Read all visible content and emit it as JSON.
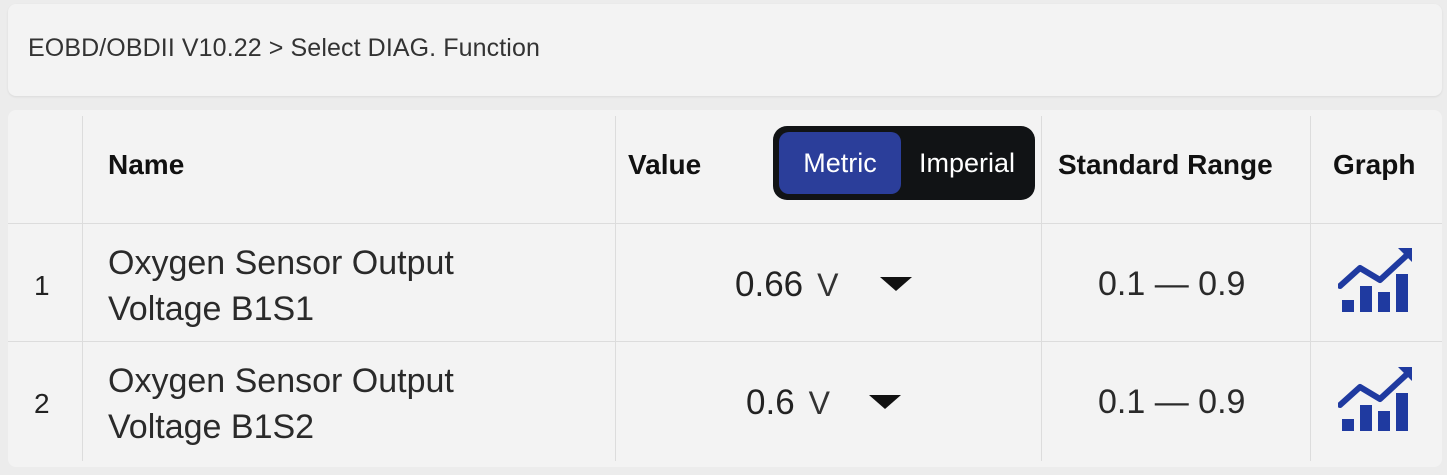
{
  "breadcrumb": {
    "text": "EOBD/OBDII V10.22 > Select DIAG. Function"
  },
  "table": {
    "headers": {
      "name": "Name",
      "value": "Value",
      "standard_range": "Standard Range",
      "graph": "Graph"
    },
    "unit_toggle": {
      "metric": "Metric",
      "imperial": "Imperial",
      "selected": "Metric"
    },
    "rows": [
      {
        "index": "1",
        "name": "Oxygen Sensor Output Voltage B1S1",
        "value": "0.66",
        "unit": "V",
        "range": "0.1 — 0.9"
      },
      {
        "index": "2",
        "name": "Oxygen Sensor Output Voltage B1S2",
        "value": "0.6",
        "unit": "V",
        "range": "0.1 — 0.9"
      }
    ]
  },
  "colors": {
    "accent": "#2b3e9a",
    "toggle_bg": "#111315",
    "graph_icon": "#1f3aa0"
  },
  "icons": {
    "graph": "bar-chart-trend-icon",
    "dropdown": "caret-down-icon"
  }
}
